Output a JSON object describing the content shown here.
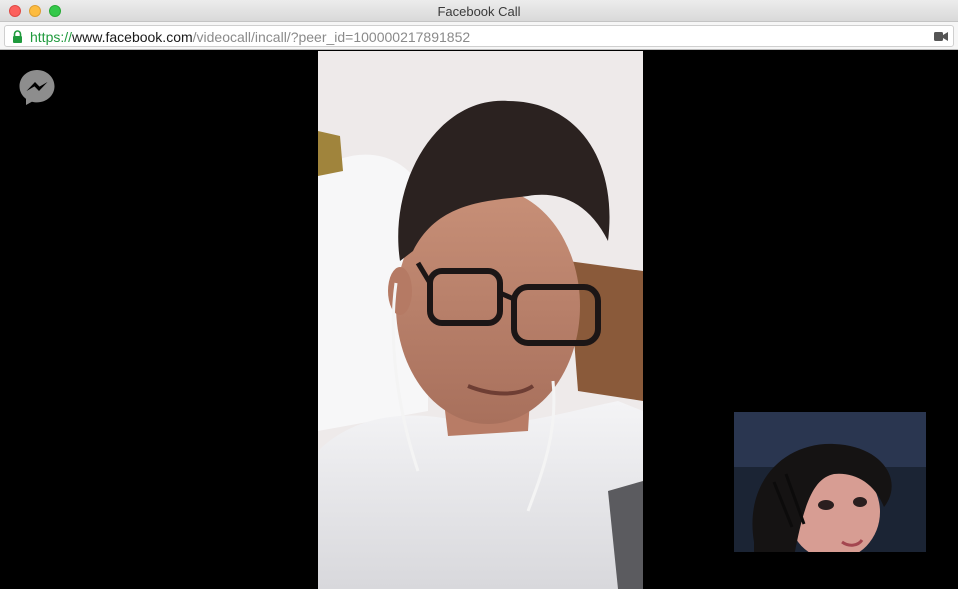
{
  "window": {
    "title": "Facebook Call"
  },
  "address_bar": {
    "scheme": "https://",
    "host": "www.facebook.com",
    "path": "/videocall/incall/?peer_id=100000217891852"
  },
  "icons": {
    "lock": "lock-icon",
    "camera": "camera-icon",
    "messenger": "messenger-icon"
  },
  "colors": {
    "scheme_green": "#1f9a3d",
    "background": "#000000"
  }
}
